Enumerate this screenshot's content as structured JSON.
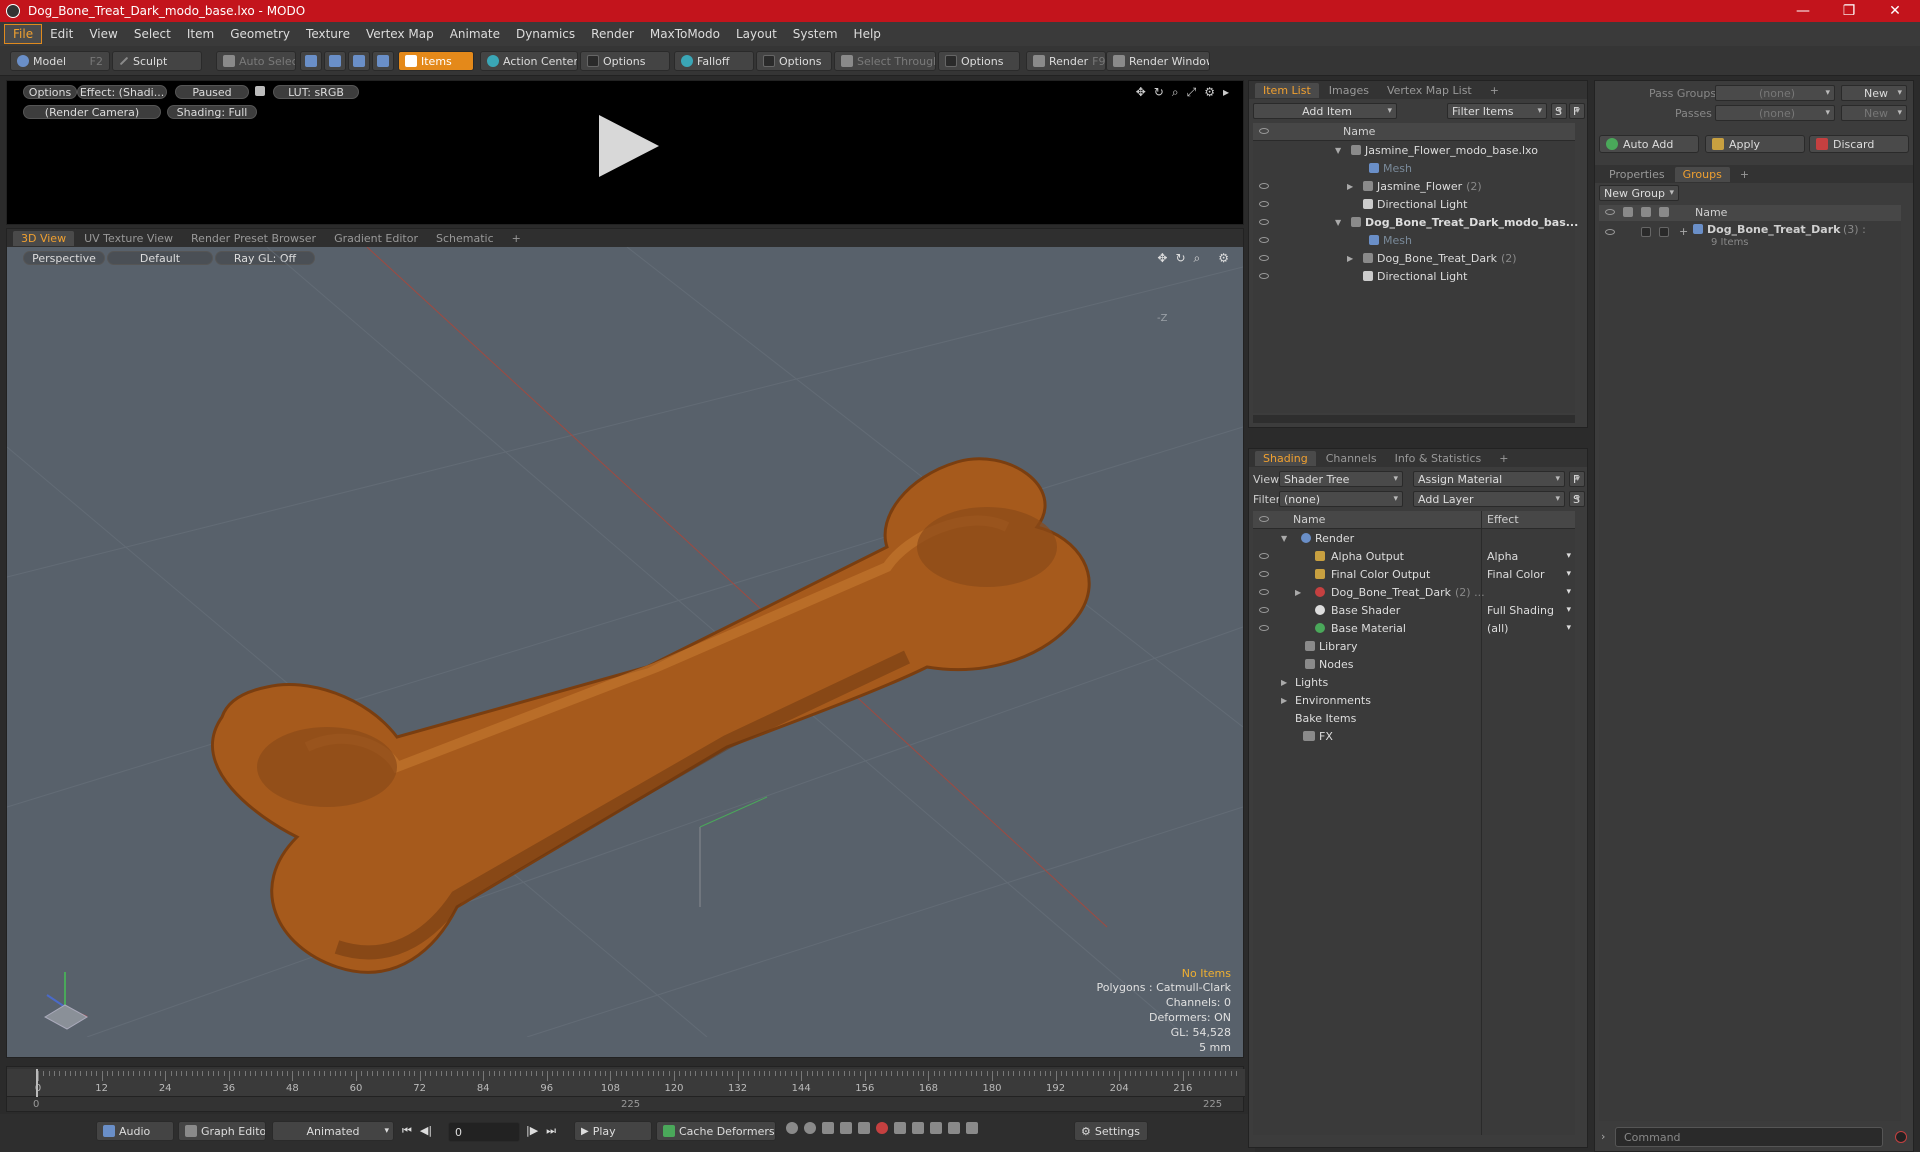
{
  "window": {
    "title": "Dog_Bone_Treat_Dark_modo_base.lxo - MODO",
    "minimize": "—",
    "maximize": "❐",
    "close": "✕"
  },
  "menu": [
    "File",
    "Edit",
    "View",
    "Select",
    "Item",
    "Geometry",
    "Texture",
    "Vertex Map",
    "Animate",
    "Dynamics",
    "Render",
    "MaxToModo",
    "Layout",
    "System",
    "Help"
  ],
  "toolbar": {
    "model": "Model",
    "model_key": "F2",
    "sculpt": "Sculpt",
    "auto_select": "Auto Select",
    "items": "Items",
    "action_center": "Action Center",
    "options1": "Options",
    "falloff": "Falloff",
    "options2": "Options",
    "select_through": "Select Through",
    "options3": "Options",
    "render": "Render",
    "render_key": "F9",
    "render_window": "Render Window"
  },
  "preview": {
    "options": "Options",
    "effect": "Effect: (Shadi...",
    "paused": "Paused",
    "lut": "LUT: sRGB",
    "camera": "(Render Camera)",
    "shading": "Shading: Full"
  },
  "viewport": {
    "tabs": [
      "3D View",
      "UV Texture View",
      "Render Preset Browser",
      "Gradient Editor",
      "Schematic"
    ],
    "perspective": "Perspective",
    "default": "Default",
    "raygl": "Ray GL: Off",
    "axis_label": "-Z",
    "hud": {
      "no_items": "No Items",
      "polygons": "Polygons : Catmull-Clark",
      "channels": "Channels: 0",
      "deformers": "Deformers: ON",
      "gl": "GL: 54,528",
      "scale": "5 mm"
    }
  },
  "timeline": {
    "ticks": [
      "0",
      "12",
      "24",
      "36",
      "48",
      "60",
      "72",
      "84",
      "96",
      "108",
      "120",
      "132",
      "144",
      "156",
      "168",
      "180",
      "192",
      "204",
      "216"
    ],
    "start": "0",
    "mid": "225",
    "end": "225"
  },
  "bottombar": {
    "audio": "Audio",
    "graph_editor": "Graph Editor",
    "animated": "Animated",
    "frame": "0",
    "play": "Play",
    "cache_deformers": "Cache Deformers",
    "settings": "Settings"
  },
  "itemlist": {
    "tabs": [
      "Item List",
      "Images",
      "Vertex Map List"
    ],
    "add_item": "Add Item",
    "filter_items": "Filter Items",
    "s": "S",
    "f": "F",
    "col_name": "Name",
    "rows": [
      {
        "label": "Jasmine_Flower_modo_base.lxo",
        "count": ""
      },
      {
        "label": "Mesh",
        "count": ""
      },
      {
        "label": "Jasmine_Flower",
        "count": "(2)"
      },
      {
        "label": "Directional Light",
        "count": ""
      },
      {
        "label": "Dog_Bone_Treat_Dark_modo_bas...",
        "count": ""
      },
      {
        "label": "Mesh",
        "count": ""
      },
      {
        "label": "Dog_Bone_Treat_Dark",
        "count": "(2)"
      },
      {
        "label": "Directional Light",
        "count": ""
      }
    ]
  },
  "shading": {
    "tabs": [
      "Shading",
      "Channels",
      "Info & Statistics"
    ],
    "view_label": "View",
    "view_value": "Shader Tree",
    "assign_material": "Assign Material",
    "f": "F",
    "filter_label": "Filter",
    "filter_value": "(none)",
    "add_layer": "Add Layer",
    "s": "S",
    "col_name": "Name",
    "col_effect": "Effect",
    "rows": [
      {
        "label": "Render",
        "effect": "",
        "count": ""
      },
      {
        "label": "Alpha Output",
        "effect": "Alpha",
        "count": ""
      },
      {
        "label": "Final Color Output",
        "effect": "Final Color",
        "count": ""
      },
      {
        "label": "Dog_Bone_Treat_Dark",
        "effect": "",
        "count": "(2) ..."
      },
      {
        "label": "Base Shader",
        "effect": "Full Shading",
        "count": ""
      },
      {
        "label": "Base Material",
        "effect": "(all)",
        "count": ""
      },
      {
        "label": "Library",
        "effect": "",
        "count": ""
      },
      {
        "label": "Nodes",
        "effect": "",
        "count": ""
      },
      {
        "label": "Lights",
        "effect": "",
        "count": ""
      },
      {
        "label": "Environments",
        "effect": "",
        "count": ""
      },
      {
        "label": "Bake Items",
        "effect": "",
        "count": ""
      },
      {
        "label": "FX",
        "effect": "",
        "count": ""
      }
    ]
  },
  "groups": {
    "pass_groups_label": "Pass Groups",
    "pass_groups_value": "(none)",
    "new": "New",
    "passes_label": "Passes",
    "passes_value": "(none)",
    "new2": "New",
    "auto_add": "Auto Add",
    "apply": "Apply",
    "discard": "Discard",
    "tabs": [
      "Properties",
      "Groups"
    ],
    "new_group": "New Group",
    "col_name": "Name",
    "group_name": "Dog_Bone_Treat_Dark",
    "group_count": "(3) :",
    "group_items": "9 Items"
  },
  "command": {
    "placeholder": "Command"
  }
}
